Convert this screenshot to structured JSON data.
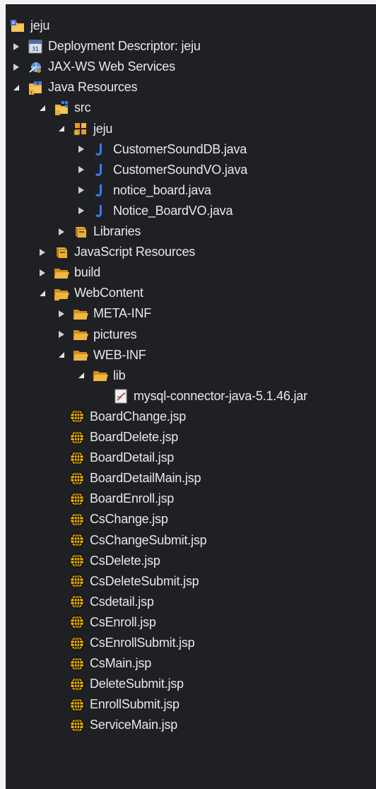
{
  "tree": [
    {
      "label": "jeju",
      "level": 0,
      "state": "none",
      "icon": "project-icon"
    },
    {
      "label": "Deployment Descriptor: jeju",
      "level": 0,
      "state": "collapsed",
      "icon": "deployment-descriptor-icon"
    },
    {
      "label": "JAX-WS Web Services",
      "level": 0,
      "state": "collapsed",
      "icon": "web-services-icon"
    },
    {
      "label": "Java Resources",
      "level": 0,
      "state": "expanded",
      "icon": "java-resources-icon"
    },
    {
      "label": "src",
      "level": 1,
      "state": "expanded",
      "icon": "source-folder-icon"
    },
    {
      "label": "jeju",
      "level": 2,
      "state": "expanded",
      "icon": "package-icon"
    },
    {
      "label": "CustomerSoundDB.java",
      "level": 3,
      "state": "collapsed",
      "icon": "java-file-icon"
    },
    {
      "label": "CustomerSoundVO.java",
      "level": 3,
      "state": "collapsed",
      "icon": "java-file-icon"
    },
    {
      "label": "notice_board.java",
      "level": 3,
      "state": "collapsed",
      "icon": "java-file-icon"
    },
    {
      "label": "Notice_BoardVO.java",
      "level": 3,
      "state": "collapsed",
      "icon": "java-file-icon"
    },
    {
      "label": "Libraries",
      "level": 2,
      "state": "collapsed",
      "icon": "library-icon"
    },
    {
      "label": "JavaScript Resources",
      "level": 1,
      "state": "collapsed",
      "icon": "library-icon"
    },
    {
      "label": "build",
      "level": 1,
      "state": "collapsed",
      "icon": "folder-icon"
    },
    {
      "label": "WebContent",
      "level": 1,
      "state": "expanded",
      "icon": "web-folder-icon"
    },
    {
      "label": "META-INF",
      "level": 2,
      "state": "collapsed",
      "icon": "folder-icon"
    },
    {
      "label": "pictures",
      "level": 2,
      "state": "collapsed",
      "icon": "folder-icon"
    },
    {
      "label": "WEB-INF",
      "level": 2,
      "state": "expanded",
      "icon": "folder-icon"
    },
    {
      "label": "lib",
      "level": 3,
      "state": "expanded",
      "icon": "folder-icon"
    },
    {
      "label": "mysql-connector-java-5.1.46.jar",
      "level": 4,
      "state": "none",
      "icon": "jar-icon"
    },
    {
      "label": "BoardChange.jsp",
      "level": 2,
      "state": "none",
      "icon": "jsp-file-icon"
    },
    {
      "label": "BoardDelete.jsp",
      "level": 2,
      "state": "none",
      "icon": "jsp-file-icon"
    },
    {
      "label": "BoardDetail.jsp",
      "level": 2,
      "state": "none",
      "icon": "jsp-file-icon"
    },
    {
      "label": "BoardDetailMain.jsp",
      "level": 2,
      "state": "none",
      "icon": "jsp-file-icon"
    },
    {
      "label": "BoardEnroll.jsp",
      "level": 2,
      "state": "none",
      "icon": "jsp-file-icon"
    },
    {
      "label": "CsChange.jsp",
      "level": 2,
      "state": "none",
      "icon": "jsp-file-icon"
    },
    {
      "label": "CsChangeSubmit.jsp",
      "level": 2,
      "state": "none",
      "icon": "jsp-file-icon"
    },
    {
      "label": "CsDelete.jsp",
      "level": 2,
      "state": "none",
      "icon": "jsp-file-icon"
    },
    {
      "label": "CsDeleteSubmit.jsp",
      "level": 2,
      "state": "none",
      "icon": "jsp-file-icon"
    },
    {
      "label": "Csdetail.jsp",
      "level": 2,
      "state": "none",
      "icon": "jsp-file-icon"
    },
    {
      "label": "CsEnroll.jsp",
      "level": 2,
      "state": "none",
      "icon": "jsp-file-icon"
    },
    {
      "label": "CsEnrollSubmit.jsp",
      "level": 2,
      "state": "none",
      "icon": "jsp-file-icon"
    },
    {
      "label": "CsMain.jsp",
      "level": 2,
      "state": "none",
      "icon": "jsp-file-icon"
    },
    {
      "label": "DeleteSubmit.jsp",
      "level": 2,
      "state": "none",
      "icon": "jsp-file-icon"
    },
    {
      "label": "EnrollSubmit.jsp",
      "level": 2,
      "state": "none",
      "icon": "jsp-file-icon"
    },
    {
      "label": "ServiceMain.jsp",
      "level": 2,
      "state": "none",
      "icon": "jsp-file-icon"
    }
  ]
}
